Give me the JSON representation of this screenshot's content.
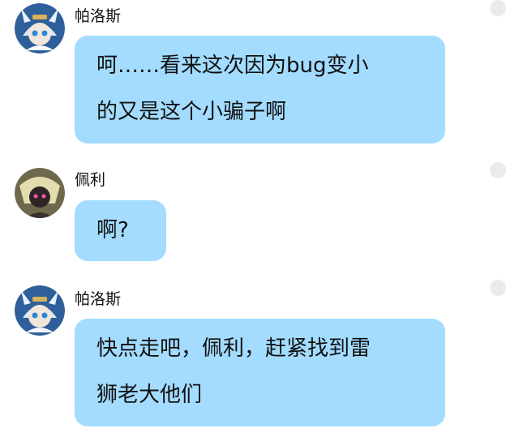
{
  "messages": [
    {
      "sender": "帕洛斯",
      "avatar_icon": "palos-avatar-icon",
      "lines": [
        "呵……看来这次因为bug变小",
        "的又是这个小骗子啊"
      ]
    },
    {
      "sender": "佩利",
      "avatar_icon": "peili-avatar-icon",
      "lines": [
        "啊?"
      ]
    },
    {
      "sender": "帕洛斯",
      "avatar_icon": "palos-avatar-icon",
      "lines": [
        "快点走吧，佩利，赶紧找到雷",
        "狮老大他们"
      ]
    }
  ],
  "colors": {
    "bubble": "#a3dcff",
    "background": "#ffffff",
    "status_dot": "#ebebeb"
  }
}
